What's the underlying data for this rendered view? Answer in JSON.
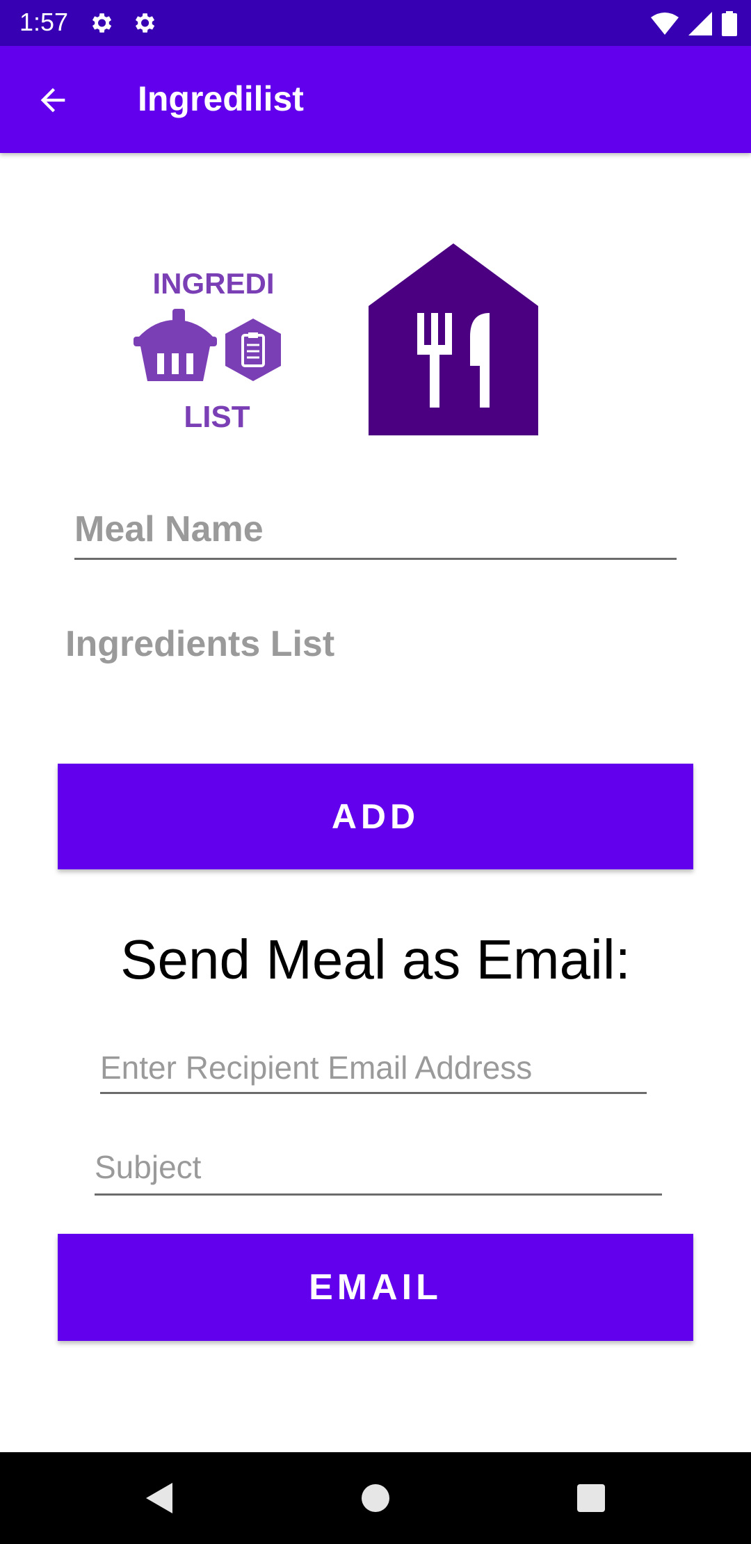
{
  "status_bar": {
    "time": "1:57",
    "icons": [
      "gear-icon",
      "gear-icon",
      "wifi-icon",
      "signal-icon",
      "battery-icon"
    ]
  },
  "app_bar": {
    "title": "Ingredilist",
    "back_icon": "arrow-back-icon"
  },
  "logos": {
    "app_logo_text_top": "INGREDI",
    "app_logo_text_bottom": "LIST",
    "meal_logo_icon": "fork-knife-house-icon"
  },
  "form": {
    "meal_name_placeholder": "Meal Name",
    "ingredients_label": "Ingredients List",
    "add_button": "ADD",
    "send_heading": "Send Meal as Email:",
    "recipient_placeholder": "Enter Recipient Email Address",
    "subject_placeholder": "Subject",
    "email_button": "EMAIL"
  },
  "nav_bar": {
    "icons": [
      "back-triangle-icon",
      "home-circle-icon",
      "recents-square-icon"
    ]
  },
  "colors": {
    "status_bar": "#3700B3",
    "app_bar": "#6200EE",
    "button": "#6200EE",
    "logo_purple": "#7B3FB5",
    "meal_logo_purple": "#4B0082",
    "hint_gray": "#9A9A9A"
  }
}
